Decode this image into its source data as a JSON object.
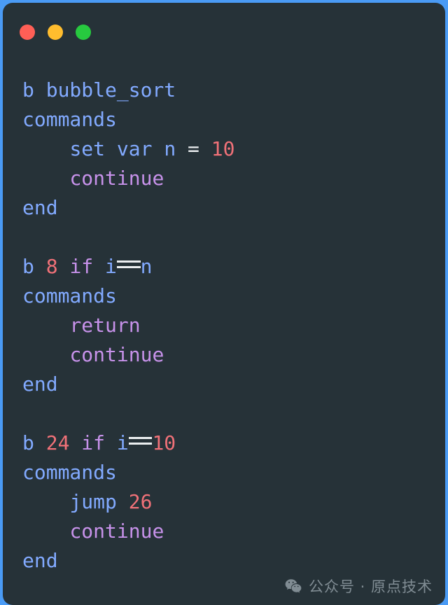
{
  "window": {
    "background_color": "#263238",
    "desktop_color": "#4a9bf5",
    "traffic_lights": [
      {
        "name": "close",
        "label": "Close",
        "color": "#FF5F56"
      },
      {
        "name": "minimize",
        "label": "Minimize",
        "color": "#FFBD2E"
      },
      {
        "name": "maximize",
        "label": "Maximize",
        "color": "#27C93F"
      }
    ]
  },
  "theme": {
    "identifier": "#82AAFF",
    "keyword": "#C792EA",
    "number": "#F07178",
    "operator": "#ECEFF1"
  },
  "code": {
    "lines": [
      {
        "indent": 0,
        "tokens": [
          {
            "t": "b",
            "c": "ident"
          },
          {
            "t": " ",
            "c": "plain"
          },
          {
            "t": "bubble_sort",
            "c": "ident"
          }
        ]
      },
      {
        "indent": 0,
        "tokens": [
          {
            "t": "commands",
            "c": "ident"
          }
        ]
      },
      {
        "indent": 4,
        "tokens": [
          {
            "t": "set",
            "c": "ident"
          },
          {
            "t": " ",
            "c": "plain"
          },
          {
            "t": "var",
            "c": "ident"
          },
          {
            "t": " ",
            "c": "plain"
          },
          {
            "t": "n",
            "c": "ident"
          },
          {
            "t": " ",
            "c": "plain"
          },
          {
            "t": "=",
            "c": "op"
          },
          {
            "t": " ",
            "c": "plain"
          },
          {
            "t": "10",
            "c": "number"
          }
        ]
      },
      {
        "indent": 4,
        "tokens": [
          {
            "t": "continue",
            "c": "keyword"
          }
        ]
      },
      {
        "indent": 0,
        "tokens": [
          {
            "t": "end",
            "c": "ident"
          }
        ]
      },
      {
        "indent": 0,
        "tokens": []
      },
      {
        "indent": 0,
        "tokens": [
          {
            "t": "b",
            "c": "ident"
          },
          {
            "t": " ",
            "c": "plain"
          },
          {
            "t": "8",
            "c": "number"
          },
          {
            "t": " ",
            "c": "plain"
          },
          {
            "t": "if",
            "c": "keyword"
          },
          {
            "t": " ",
            "c": "plain"
          },
          {
            "t": "i",
            "c": "ident"
          },
          {
            "t": "==",
            "c": "eqlig"
          },
          {
            "t": "n",
            "c": "ident"
          }
        ]
      },
      {
        "indent": 0,
        "tokens": [
          {
            "t": "commands",
            "c": "ident"
          }
        ]
      },
      {
        "indent": 4,
        "tokens": [
          {
            "t": "return",
            "c": "keyword"
          }
        ]
      },
      {
        "indent": 4,
        "tokens": [
          {
            "t": "continue",
            "c": "keyword"
          }
        ]
      },
      {
        "indent": 0,
        "tokens": [
          {
            "t": "end",
            "c": "ident"
          }
        ]
      },
      {
        "indent": 0,
        "tokens": []
      },
      {
        "indent": 0,
        "tokens": [
          {
            "t": "b",
            "c": "ident"
          },
          {
            "t": " ",
            "c": "plain"
          },
          {
            "t": "24",
            "c": "number"
          },
          {
            "t": " ",
            "c": "plain"
          },
          {
            "t": "if",
            "c": "keyword"
          },
          {
            "t": " ",
            "c": "plain"
          },
          {
            "t": "i",
            "c": "ident"
          },
          {
            "t": "==",
            "c": "eqlig"
          },
          {
            "t": "10",
            "c": "number"
          }
        ]
      },
      {
        "indent": 0,
        "tokens": [
          {
            "t": "commands",
            "c": "ident"
          }
        ]
      },
      {
        "indent": 4,
        "tokens": [
          {
            "t": "jump",
            "c": "ident"
          },
          {
            "t": " ",
            "c": "plain"
          },
          {
            "t": "26",
            "c": "number"
          }
        ]
      },
      {
        "indent": 4,
        "tokens": [
          {
            "t": "continue",
            "c": "keyword"
          }
        ]
      },
      {
        "indent": 0,
        "tokens": [
          {
            "t": "end",
            "c": "ident"
          }
        ]
      }
    ]
  },
  "watermark": {
    "icon": "wechat-icon",
    "text": "公众号 · 原点技术",
    "color": "#B8C4CC"
  }
}
